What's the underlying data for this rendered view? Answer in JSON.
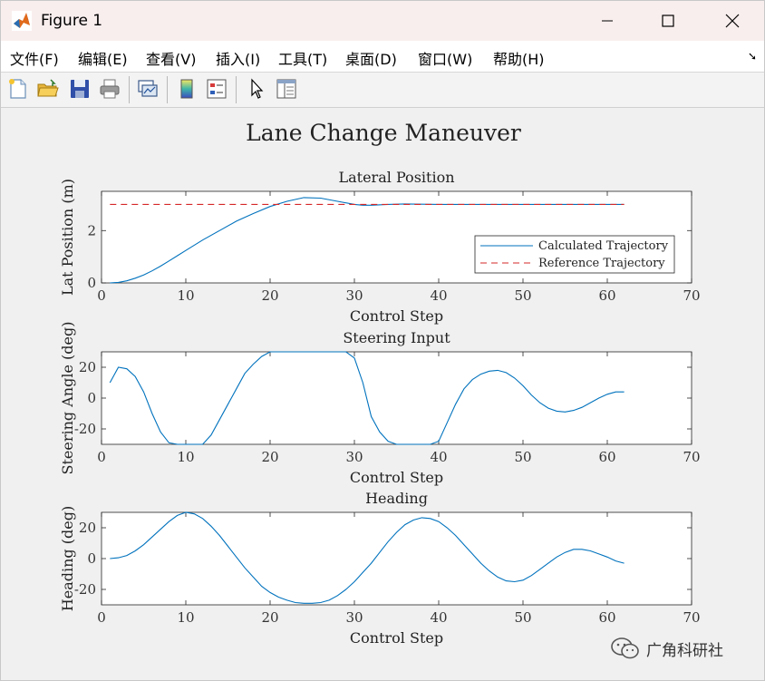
{
  "window": {
    "title": "Figure 1",
    "min_label": "",
    "max_label": "",
    "close_label": ""
  },
  "menu": {
    "items": [
      "文件(F)",
      "编辑(E)",
      "查看(V)",
      "插入(I)",
      "工具(T)",
      "桌面(D)",
      "窗口(W)",
      "帮助(H)"
    ]
  },
  "toolbar": {
    "icons": [
      "new-figure-icon",
      "open-file-icon",
      "save-icon",
      "print-icon",
      "link-plot-icon",
      "colorbar-icon",
      "legend-icon",
      "pointer-icon",
      "property-editor-icon"
    ]
  },
  "figure": {
    "suptitle": "Lane Change Maneuver"
  },
  "watermark": {
    "text": "广角科研社"
  },
  "chart_data": [
    {
      "type": "line",
      "title": "Lateral Position",
      "xlabel": "Control Step",
      "ylabel": "Lat Position (m)",
      "xlim": [
        0,
        70
      ],
      "ylim": [
        0,
        3.5
      ],
      "xticks": [
        0,
        10,
        20,
        30,
        40,
        50,
        60,
        70
      ],
      "yticks": [
        0,
        2
      ],
      "legend": "bottom-right",
      "series": [
        {
          "name": "Calculated Trajectory",
          "color": "#0072bd",
          "style": "solid",
          "x": [
            1,
            2,
            3,
            4,
            5,
            6,
            7,
            8,
            9,
            10,
            12,
            14,
            16,
            18,
            20,
            22,
            24,
            26,
            28,
            30,
            31,
            32,
            34,
            36,
            40,
            45,
            50,
            55,
            60,
            62
          ],
          "y": [
            0.0,
            0.02,
            0.08,
            0.18,
            0.3,
            0.46,
            0.64,
            0.84,
            1.04,
            1.24,
            1.64,
            2.0,
            2.36,
            2.65,
            2.92,
            3.12,
            3.26,
            3.24,
            3.12,
            3.0,
            2.97,
            2.97,
            3.0,
            3.02,
            3.0,
            3.0,
            3.0,
            3.0,
            3.0,
            3.0
          ]
        },
        {
          "name": "Reference Trajectory",
          "color": "#d62728",
          "style": "dashed",
          "x": [
            1,
            62
          ],
          "y": [
            3.0,
            3.0
          ]
        }
      ]
    },
    {
      "type": "line",
      "title": "Steering Input",
      "xlabel": "Control Step",
      "ylabel": "Steering Angle (deg)",
      "xlim": [
        0,
        70
      ],
      "ylim": [
        -30,
        30
      ],
      "xticks": [
        0,
        10,
        20,
        30,
        40,
        50,
        60,
        70
      ],
      "yticks": [
        -20,
        0,
        20
      ],
      "series": [
        {
          "color": "#0072bd",
          "style": "solid",
          "x": [
            1,
            2,
            3,
            4,
            5,
            6,
            7,
            8,
            9,
            10,
            11,
            12,
            13,
            14,
            15,
            16,
            17,
            18,
            19,
            20,
            21,
            29,
            30,
            31,
            32,
            33,
            34,
            35,
            36,
            37,
            38,
            39,
            40,
            41,
            42,
            43,
            44,
            45,
            46,
            47,
            48,
            49,
            50,
            51,
            52,
            53,
            54,
            55,
            56,
            57,
            58,
            59,
            60,
            61,
            62
          ],
          "y": [
            10,
            20,
            19,
            14,
            4,
            -10,
            -22,
            -29,
            -30,
            -30,
            -30,
            -30,
            -24,
            -14,
            -4,
            6,
            16,
            22,
            27,
            30,
            30,
            30,
            26,
            10,
            -12,
            -22,
            -28,
            -30,
            -30,
            -30,
            -30,
            -30,
            -28,
            -16,
            -4,
            6,
            12,
            15.5,
            17.5,
            18,
            16.5,
            13,
            8,
            2,
            -3,
            -6.5,
            -8.5,
            -9,
            -8,
            -6,
            -3,
            0,
            2.5,
            4,
            4
          ]
        }
      ]
    },
    {
      "type": "line",
      "title": "Heading",
      "xlabel": "Control Step",
      "ylabel": "Heading (deg)",
      "xlim": [
        0,
        70
      ],
      "ylim": [
        -30,
        30
      ],
      "xticks": [
        0,
        10,
        20,
        30,
        40,
        50,
        60,
        70
      ],
      "yticks": [
        -20,
        0,
        20
      ],
      "series": [
        {
          "color": "#0072bd",
          "style": "solid",
          "x": [
            1,
            2,
            3,
            4,
            5,
            6,
            7,
            8,
            9,
            10,
            11,
            12,
            13,
            14,
            15,
            16,
            17,
            18,
            19,
            20,
            21,
            22,
            23,
            24,
            25,
            26,
            27,
            28,
            29,
            30,
            31,
            32,
            33,
            34,
            35,
            36,
            37,
            38,
            39,
            40,
            41,
            42,
            43,
            44,
            45,
            46,
            47,
            48,
            49,
            50,
            51,
            52,
            53,
            54,
            55,
            56,
            57,
            58,
            59,
            60,
            61,
            62
          ],
          "y": [
            0,
            0.5,
            2,
            5,
            9,
            14,
            19,
            24,
            28,
            30,
            29,
            26,
            21,
            15,
            8,
            1,
            -6,
            -12,
            -18,
            -22,
            -25,
            -27,
            -28.5,
            -29,
            -29,
            -28.5,
            -27,
            -24,
            -20,
            -15,
            -9,
            -3,
            4,
            11,
            17,
            22,
            25,
            26.5,
            26,
            24,
            20,
            15,
            9,
            3,
            -3,
            -8,
            -12,
            -14.5,
            -15,
            -14,
            -11,
            -7,
            -3,
            1,
            4,
            6,
            6,
            5,
            3,
            1,
            -1.5,
            -3
          ]
        }
      ]
    }
  ]
}
